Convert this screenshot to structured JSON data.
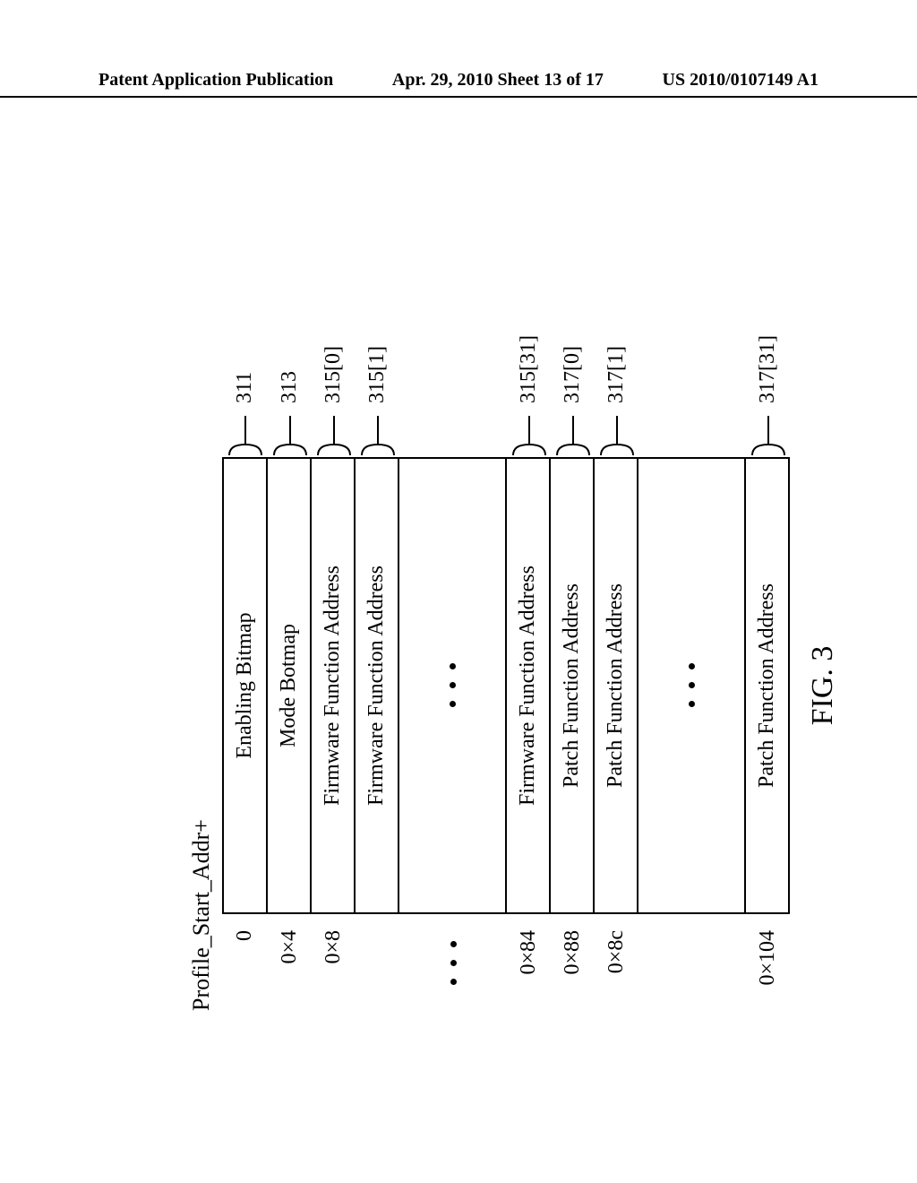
{
  "header": {
    "left": "Patent Application Publication",
    "center": "Apr. 29, 2010  Sheet 13 of 17",
    "right": "US 2010/0107149 A1"
  },
  "figure": {
    "profile_label": "Profile_Start_Addr+",
    "caption": "FIG. 3",
    "rows": [
      {
        "offset": "0",
        "label": "Enabling Bitmap",
        "ref": "311"
      },
      {
        "offset": "0×4",
        "label": "Mode Botmap",
        "ref": "313"
      },
      {
        "offset": "0×8",
        "label": "Firmware Function Address",
        "ref": "315[0]"
      },
      {
        "offset": "",
        "label": "Firmware Function Address",
        "ref": "315[1]"
      },
      {
        "ellipsis": true
      },
      {
        "offset": "0×84",
        "label": "Firmware Function Address",
        "ref": "315[31]"
      },
      {
        "offset": "0×88",
        "label": "Patch Function Address",
        "ref": "317[0]"
      },
      {
        "offset": "0×8c",
        "label": "Patch Function Address",
        "ref": "317[1]"
      },
      {
        "ellipsis": true
      },
      {
        "offset": "0×104",
        "label": "Patch Function Address",
        "ref": "317[31]"
      }
    ]
  }
}
